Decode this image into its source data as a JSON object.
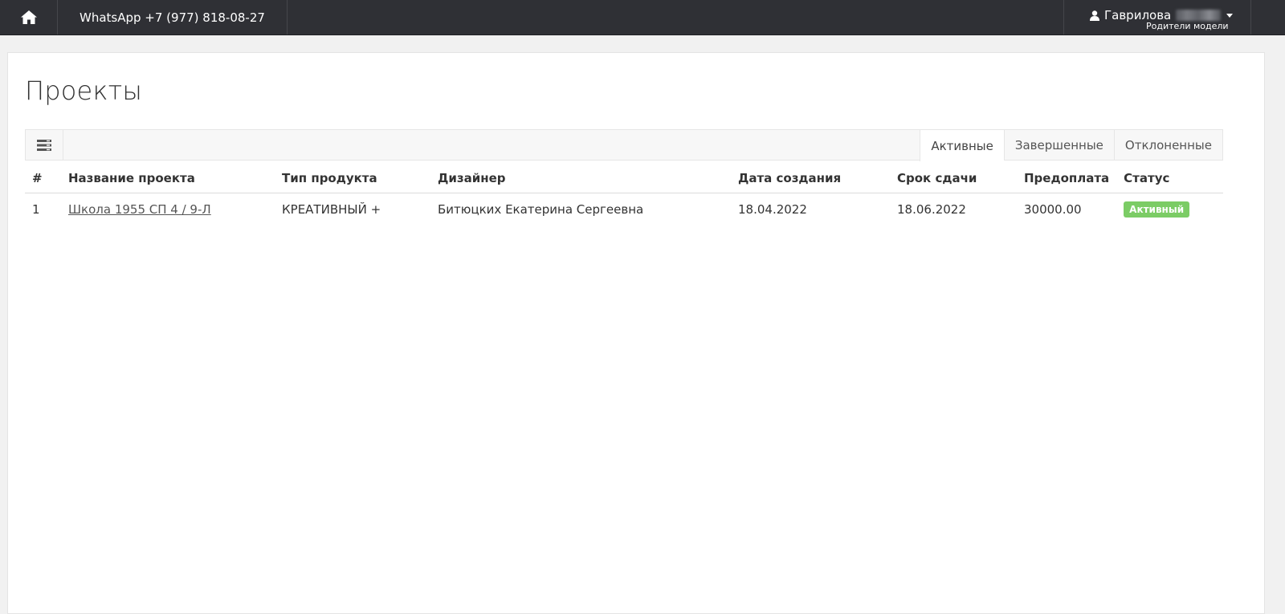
{
  "topbar": {
    "phone": "WhatsApp +7 (977) 818-08-27",
    "user_name": "Гаврилова",
    "user_name_tail": "",
    "user_role": "Родители модели"
  },
  "page": {
    "title": "Проекты"
  },
  "tabs": [
    {
      "label": "Активные",
      "active": true
    },
    {
      "label": "Завершенные",
      "active": false
    },
    {
      "label": "Отклоненные",
      "active": false
    }
  ],
  "table": {
    "headers": [
      "#",
      "Название проекта",
      "Тип продукта",
      "Дизайнер",
      "Дата создания",
      "Срок сдачи",
      "Предоплата",
      "Статус"
    ],
    "rows": [
      {
        "num": "1",
        "name": "Школа 1955 СП 4 / 9-Л",
        "product": "КРЕАТИВНЫЙ +",
        "designer": "Битюцких Екатерина Сергеевна",
        "created": "18.04.2022",
        "deadline": "18.06.2022",
        "prepay": "30000.00",
        "status": "Активный"
      }
    ]
  },
  "colors": {
    "topbar": "#2f3035",
    "status_active": "#7bcc65"
  },
  "icons": {
    "home": "home-icon",
    "user": "user-icon",
    "toolbar": "list-settings-icon"
  }
}
